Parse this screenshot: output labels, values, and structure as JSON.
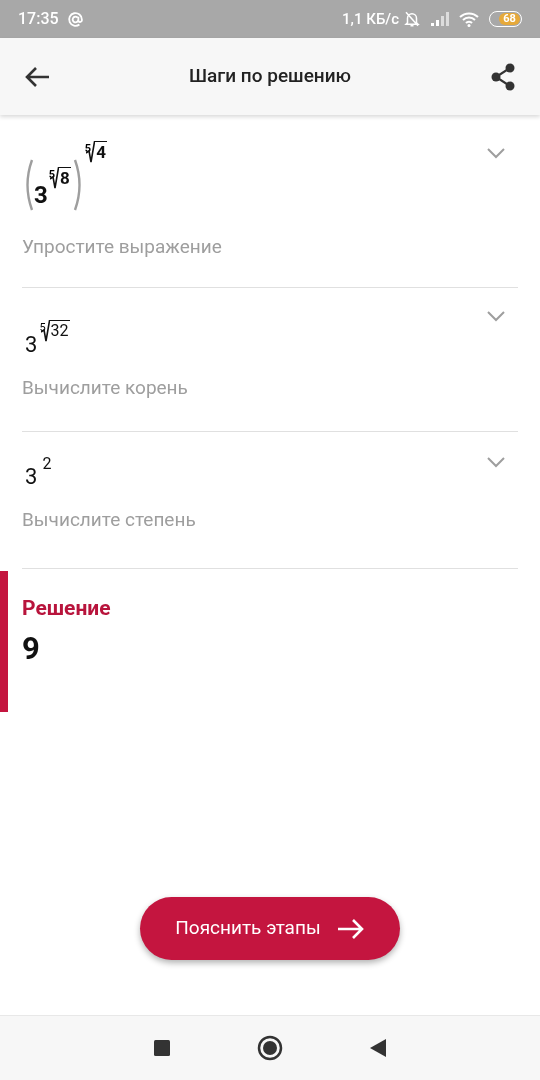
{
  "status_bar": {
    "time": "17:35",
    "speed": "1,1 КБ/с",
    "battery": "68"
  },
  "header": {
    "title": "Шаги по решению"
  },
  "steps": [
    {
      "kind": "nested",
      "base": "3",
      "inner_index": "5",
      "inner_radicand": "8",
      "outer_index": "5",
      "outer_radicand": "4",
      "caption": "Упростите выражение",
      "expanded": false
    },
    {
      "kind": "root_exponent",
      "base": "3",
      "index": "5",
      "radicand": "32",
      "caption": "Вычислите корень",
      "expanded": false
    },
    {
      "kind": "power",
      "base": "3",
      "exponent": "2",
      "caption": "Вычислите степень",
      "expanded": false
    }
  ],
  "solution": {
    "label": "Решение",
    "value": "9"
  },
  "action_button": {
    "label": "Пояснить этапы"
  }
}
